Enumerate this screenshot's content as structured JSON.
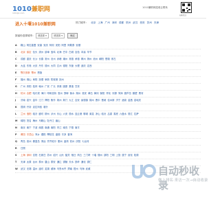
{
  "header": {
    "logo_num": "1010",
    "logo_text": "兼职网",
    "logo_sub": "1010jz.com",
    "note": "1010兼职网招收云联系",
    "qr_caption": "扫码关注"
  },
  "title": "进入十堰1010兼职网",
  "hot_label": "热门城市：",
  "hot_cities": [
    "北京",
    "上海",
    "广州",
    "深圳",
    "成都",
    "杭州",
    "武汉",
    "西安",
    "苏州",
    "天津"
  ],
  "search": {
    "label": "按省份选择城市：",
    "province": "请选择",
    "city": "请选择",
    "button": "确定"
  },
  "rows": [
    {
      "letter": "A",
      "cities": [
        "鞍山",
        "阿拉善盟",
        "安康",
        "安庆",
        "阿坝",
        "安阳",
        "阿里",
        "阿勒泰",
        "安顺"
      ]
    },
    {
      "letter": "B",
      "cities": [
        "北京",
        "保定",
        "包头",
        "滨州",
        "蚌埠",
        "宝鸡",
        "北海",
        "巴中",
        "白城",
        "百色",
        "本溪",
        "毕节"
      ]
    },
    {
      "letter": "C",
      "cities": [
        "成都",
        "重庆",
        "长沙",
        "长春",
        "常州",
        "沧州",
        "赤峰",
        "潮州",
        "常德",
        "承德",
        "郴州",
        "滁州",
        "池州",
        "朝阳",
        "楚雄",
        "崇左"
      ]
    },
    {
      "letter": "D",
      "cities": [
        "大连",
        "东莞",
        "大庆",
        "丹东",
        "德州",
        "大同",
        "达州",
        "德阳",
        "东营",
        "大理",
        "迪庆",
        "定西"
      ]
    },
    {
      "letter": "E",
      "cities": [
        "鄂尔多斯",
        "鄂州",
        "恩施"
      ]
    },
    {
      "letter": "F",
      "cities": [
        "福州",
        "佛山",
        "阜阳",
        "抚顺",
        "阜新",
        "防城港",
        "抚州"
      ]
    },
    {
      "letter": "G",
      "cities": [
        "广州",
        "贵阳",
        "桂林",
        "赣州",
        "广安",
        "广元",
        "贵港",
        "固原",
        "果洛",
        "甘孜"
      ]
    },
    {
      "letter": "H",
      "cities": [
        "杭州",
        "合肥",
        "哈尔滨",
        "海口",
        "呼和浩特",
        "惠州",
        "邯郸",
        "衡水",
        "湖州",
        "淮安",
        "黄石",
        "黄冈",
        "衡阳",
        "怀化",
        "河源",
        "菏泽",
        "葫芦岛",
        "鹤壁",
        "黑河"
      ]
    },
    {
      "letter": "J",
      "cities": [
        "济南",
        "嘉兴",
        "金华",
        "江门",
        "揭阳",
        "焦作",
        "荆州",
        "荆门",
        "九江",
        "吉安",
        "景德镇",
        "锦州",
        "晋中",
        "晋城",
        "佳木斯",
        "济宁",
        "酒泉",
        "金昌",
        "嘉峪关"
      ]
    },
    {
      "letter": "K",
      "cities": [
        "昆明",
        "开封",
        "克拉玛依",
        "喀什"
      ]
    },
    {
      "letter": "L",
      "cities": [
        "兰州",
        "洛阳",
        "临沂",
        "廊坊",
        "柳州",
        "泸州",
        "乐山",
        "六安",
        "丽水",
        "连云港",
        "聊城",
        "莱芜",
        "凉山",
        "临汾",
        "吕梁",
        "娄底",
        "六盘水",
        "丽江",
        "拉萨"
      ]
    },
    {
      "letter": "M",
      "cities": [
        "绵阳",
        "茂名",
        "梅州",
        "马鞍山",
        "牡丹江",
        "眉山"
      ]
    },
    {
      "letter": "N",
      "cities": [
        "南京",
        "南宁",
        "宁波",
        "南昌",
        "南通",
        "南阳",
        "内江",
        "南充",
        "宁德",
        "南平"
      ]
    },
    {
      "letter": "P",
      "cities": [
        "莆田",
        "平顶山",
        "萍乡",
        "濮阳",
        "攀枝花",
        "盘锦",
        "平凉",
        "普洱"
      ]
    },
    {
      "letter": "Q",
      "cities": [
        "青岛",
        "泉州",
        "秦皇岛",
        "清远",
        "齐齐哈尔",
        "衢州",
        "曲靖",
        "钦州",
        "庆阳",
        "七台河"
      ]
    },
    {
      "letter": "R",
      "cities": [
        "日照"
      ]
    },
    {
      "letter": "S",
      "cities": [
        "上海",
        "深圳",
        "沈阳",
        "石家庄",
        "苏州",
        "绍兴",
        "汕头",
        "韶关",
        "宿迁",
        "商丘",
        "三门峡",
        "十堰",
        "随州",
        "邵阳",
        "三明",
        "上饶",
        "遂宁",
        "绥化",
        "松原"
      ]
    },
    {
      "letter": "T",
      "cities": [
        "天津",
        "太原",
        "台州",
        "泰州",
        "唐山",
        "泰安",
        "通辽",
        "铜陵",
        "天水",
        "铁岭",
        "通化",
        "铜仁"
      ]
    },
    {
      "letter": "W",
      "cities": [
        "武汉",
        "无锡",
        "温州",
        "潍坊",
        "芜湖",
        "威海",
        "乌鲁木齐",
        "渭南",
        "梧州",
        "乌海",
        "武威"
      ]
    }
  ],
  "watermark": {
    "text": "自动秒收录",
    "sub": "做上排名·来访一次→自动收录"
  },
  "colors": {
    "accent": "#e07020",
    "link": "#2a5ea8",
    "highlight": "#e05a2a"
  }
}
